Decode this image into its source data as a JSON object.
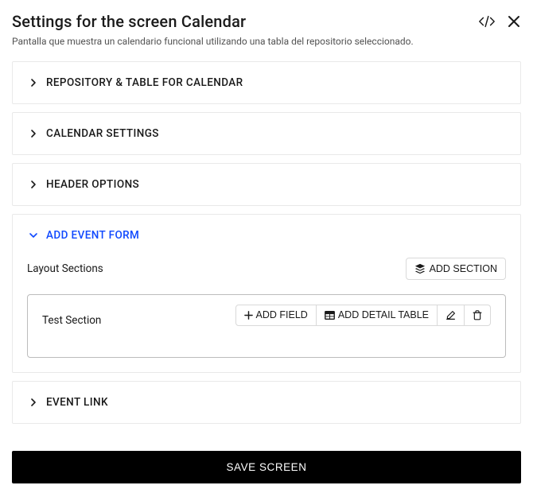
{
  "header": {
    "title": "Settings for the screen Calendar",
    "subtitle": "Pantalla que muestra un calendario funcional utilizando una tabla del repositorio seleccionado."
  },
  "panels": {
    "repository": {
      "title": "REPOSITORY & TABLE FOR CALENDAR"
    },
    "calendar_settings": {
      "title": "CALENDAR SETTINGS"
    },
    "header_options": {
      "title": "HEADER OPTIONS"
    },
    "add_event_form": {
      "title": "ADD EVENT FORM",
      "layout_label": "Layout Sections",
      "add_section_label": "ADD SECTION",
      "sections": [
        {
          "name": "Test Section",
          "add_field_label": "ADD FIELD",
          "add_detail_table_label": "ADD DETAIL TABLE"
        }
      ]
    },
    "event_link": {
      "title": "EVENT LINK"
    }
  },
  "footer": {
    "save_label": "SAVE SCREEN"
  }
}
